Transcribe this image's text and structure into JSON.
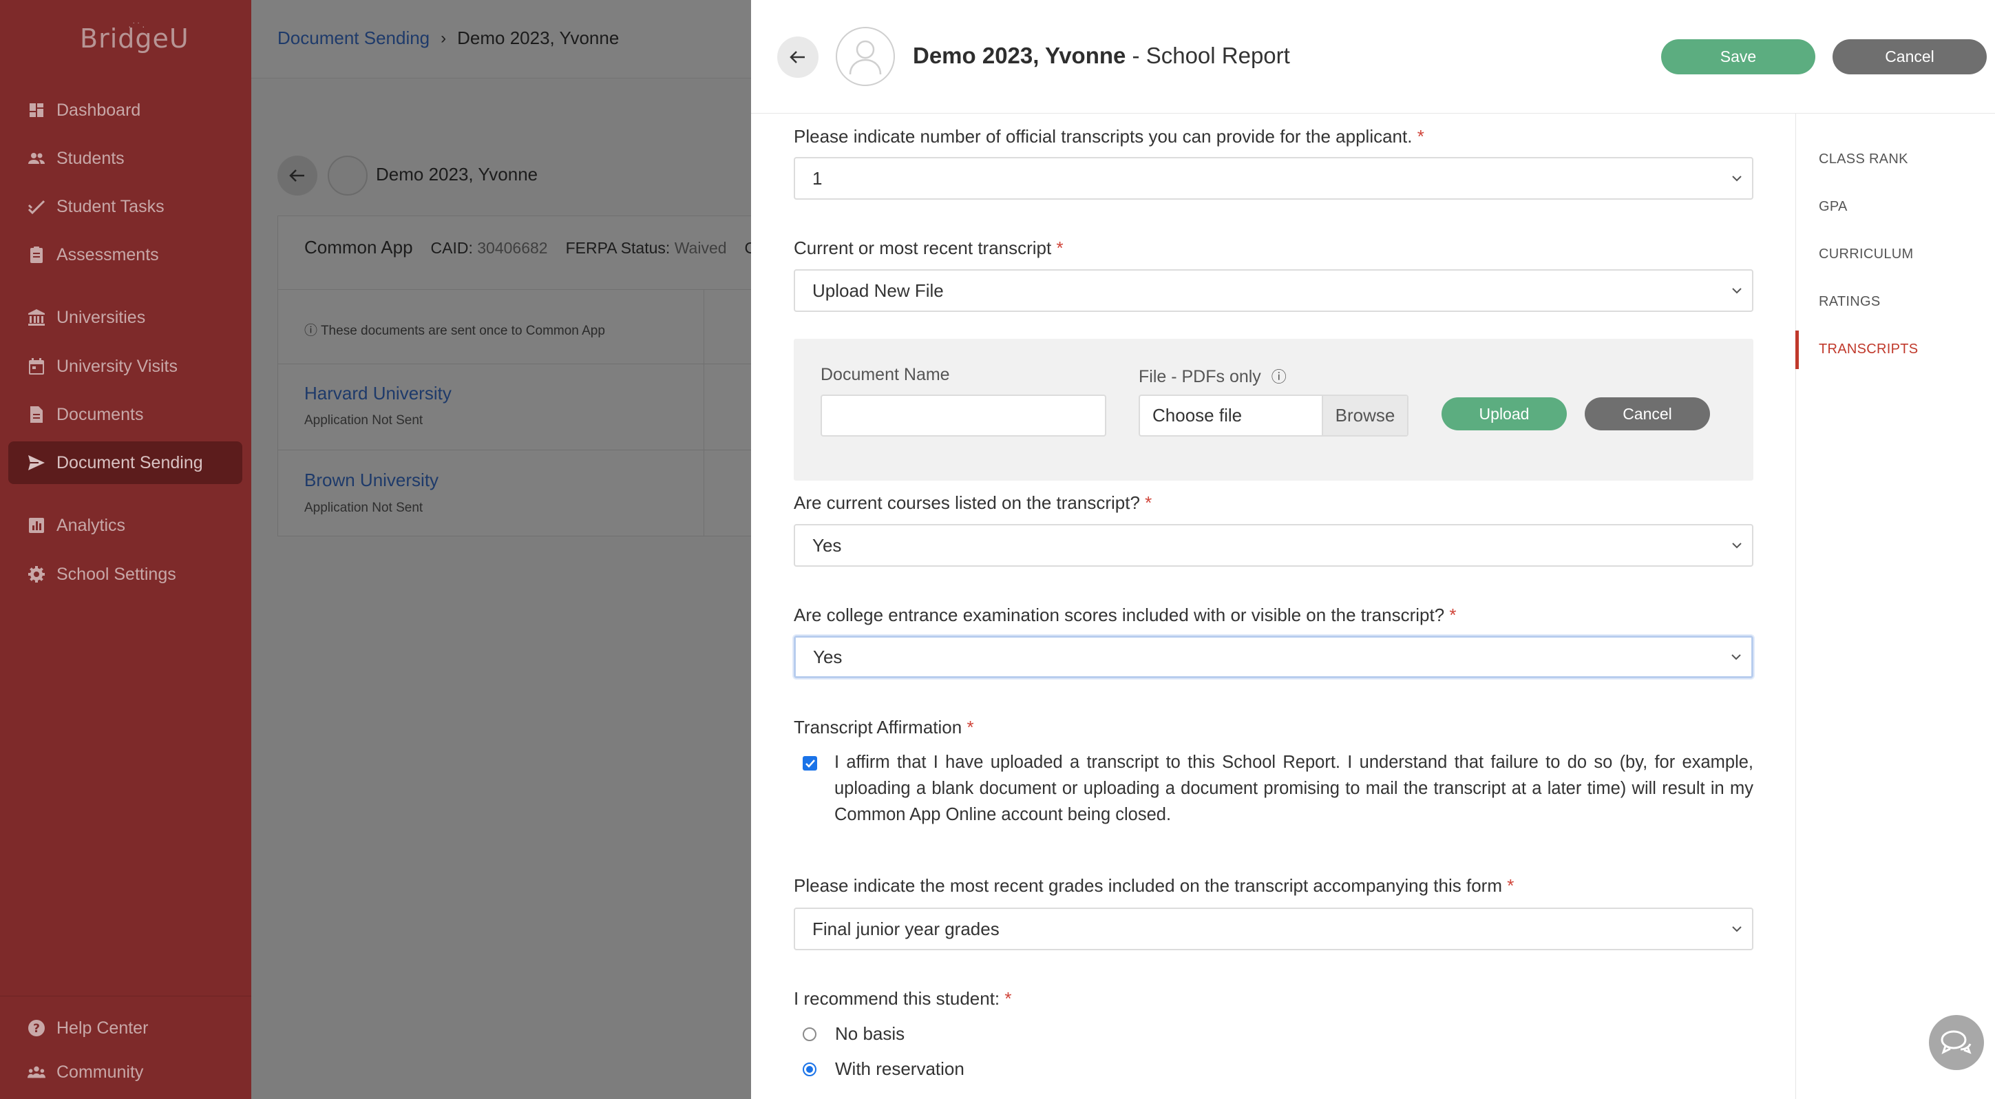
{
  "sidebar": {
    "logo": "BridgeU",
    "items": [
      {
        "label": "Dashboard",
        "icon": "dashboard-icon"
      },
      {
        "label": "Students",
        "icon": "students-icon"
      },
      {
        "label": "Student Tasks",
        "icon": "tasks-icon"
      },
      {
        "label": "Assessments",
        "icon": "assessments-icon"
      },
      {
        "label": "Universities",
        "icon": "university-icon"
      },
      {
        "label": "University Visits",
        "icon": "calendar-icon"
      },
      {
        "label": "Documents",
        "icon": "document-icon"
      },
      {
        "label": "Document Sending",
        "icon": "send-icon",
        "active": true
      },
      {
        "label": "Analytics",
        "icon": "analytics-icon"
      },
      {
        "label": "School Settings",
        "icon": "gear-icon"
      }
    ],
    "footer": [
      {
        "label": "Help Center",
        "icon": "help-icon"
      },
      {
        "label": "Community",
        "icon": "community-icon"
      }
    ]
  },
  "background": {
    "breadcrumb": {
      "link": "Document Sending",
      "current": "Demo 2023, Yvonne"
    },
    "student_name": "Demo 2023, Yvonne",
    "card": {
      "app": "Common App",
      "caid_label": "CAID:",
      "caid": "30406682",
      "ferpa_label": "FERPA Status:",
      "ferpa": "Waived",
      "cut": "Co",
      "note": "These documents are sent once to Common App",
      "universities": [
        {
          "name": "Harvard University",
          "status": "Application Not Sent"
        },
        {
          "name": "Brown University",
          "status": "Application Not Sent"
        }
      ]
    }
  },
  "panel": {
    "student": "Demo 2023, Yvonne",
    "title_suffix": " - School Report",
    "save_label": "Save",
    "cancel_label": "Cancel",
    "right_nav": [
      "CLASS RANK",
      "GPA",
      "CURRICULUM",
      "RATINGS",
      "TRANSCRIPTS"
    ],
    "right_nav_active": "TRANSCRIPTS",
    "questions": {
      "transcripts_count": {
        "label": "Please indicate number of official transcripts you can provide for the applicant.",
        "value": "1"
      },
      "recent_transcript": {
        "label": "Current or most recent transcript",
        "value": "Upload New File"
      },
      "upload": {
        "doc_name_label": "Document Name",
        "file_label": "File - PDFs only",
        "choose_file": "Choose file",
        "browse": "Browse",
        "upload_label": "Upload",
        "cancel_label": "Cancel"
      },
      "current_courses": {
        "label": "Are current courses listed on the transcript?",
        "value": "Yes"
      },
      "exam_scores": {
        "label": "Are college entrance examination scores included with or visible on the transcript?",
        "value": "Yes"
      },
      "affirmation": {
        "label": "Transcript Affirmation",
        "checked": true,
        "text": "I affirm that I have uploaded a transcript to this School Report. I understand that failure to do so (by, for example, uploading a blank document or uploading a document promising to mail the transcript at a later time) will result in my Common App Online account being closed."
      },
      "recent_grades": {
        "label": "Please indicate the most recent grades included on the transcript accompanying this form",
        "value": "Final junior year grades"
      },
      "recommend": {
        "label": "I recommend this student:",
        "options": [
          "No basis",
          "With reservation"
        ],
        "selected": "With reservation"
      }
    },
    "required_mark": "*"
  },
  "colors": {
    "sidebar": "#7e2a2a",
    "primary_green": "#5cad80",
    "secondary_gray": "#6f6f6f",
    "accent_red": "#c0392b",
    "link_blue": "#1e3a6a"
  }
}
